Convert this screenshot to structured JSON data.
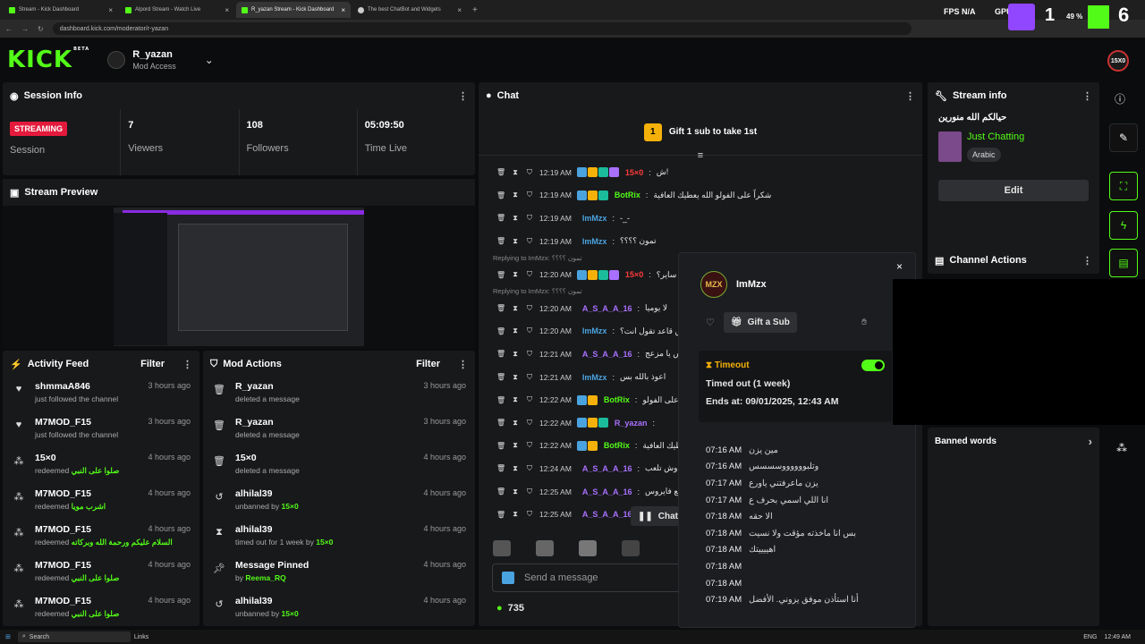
{
  "browser": {
    "tabs": [
      {
        "label": "Stream - Kick Dashboard",
        "active": false
      },
      {
        "label": "Alpord Stream - Watch Live",
        "active": false
      },
      {
        "label": "R_yazan Stream - Kick Dashboard",
        "active": true
      },
      {
        "label": "The best ChatBot and Widgets",
        "active": false
      }
    ],
    "url": "dashboard.kick.com/moderator/r-yazan"
  },
  "overlay": {
    "fps_label": "FPS",
    "fps_value": "N/A",
    "gpu_label": "GPU",
    "gpu_value": "49 %",
    "digit_1": "1",
    "digit_2": "6"
  },
  "header": {
    "logo": "KICK",
    "beta": "BETA",
    "username": "R_yazan",
    "role": "Mod Access",
    "badge": "15X0"
  },
  "session": {
    "title": "Session Info",
    "status": "STREAMING",
    "status_label": "Session",
    "viewers": "7",
    "viewers_label": "Viewers",
    "followers": "108",
    "followers_label": "Followers",
    "time_live": "05:09:50",
    "time_live_label": "Time Live"
  },
  "preview": {
    "title": "Stream Preview"
  },
  "activity": {
    "title": "Activity Feed",
    "filter": "Filter",
    "items": [
      {
        "name": "shmmaA846",
        "time": "3 hours ago",
        "action": "just followed the channel",
        "extra": "",
        "icon": "heart-icon"
      },
      {
        "name": "M7MOD_F15",
        "time": "3 hours ago",
        "action": "just followed the channel",
        "extra": "",
        "icon": "heart-icon"
      },
      {
        "name": "15×0",
        "time": "4 hours ago",
        "action": "redeemed",
        "extra": "صلوا على النبي",
        "icon": "redeem-icon"
      },
      {
        "name": "M7MOD_F15",
        "time": "4 hours ago",
        "action": "redeemed",
        "extra": "اشرب مويا",
        "icon": "redeem-icon"
      },
      {
        "name": "M7MOD_F15",
        "time": "4 hours ago",
        "action": "redeemed",
        "extra": "السلام عليكم ورحمة الله وبركاته",
        "icon": "redeem-icon"
      },
      {
        "name": "M7MOD_F15",
        "time": "4 hours ago",
        "action": "redeemed",
        "extra": "صلوا على النبي",
        "icon": "redeem-icon"
      },
      {
        "name": "M7MOD_F15",
        "time": "4 hours ago",
        "action": "redeemed",
        "extra": "صلوا على النبي",
        "icon": "redeem-icon"
      }
    ]
  },
  "modactions": {
    "title": "Mod Actions",
    "filter": "Filter",
    "items": [
      {
        "name": "R_yazan",
        "time": "3 hours ago",
        "action": "deleted a message",
        "extra": "",
        "icon": "trash-icon"
      },
      {
        "name": "R_yazan",
        "time": "3 hours ago",
        "action": "deleted a message",
        "extra": "",
        "icon": "trash-icon"
      },
      {
        "name": "15×0",
        "time": "4 hours ago",
        "action": "deleted a message",
        "extra": "",
        "icon": "trash-icon"
      },
      {
        "name": "alhilal39",
        "time": "4 hours ago",
        "action": "unbanned by",
        "extra": "15×0",
        "icon": "undo-icon"
      },
      {
        "name": "alhilal39",
        "time": "4 hours ago",
        "action": "timed out for 1 week by",
        "extra": "15×0",
        "icon": "hourglass-icon"
      },
      {
        "name": "Message Pinned",
        "time": "4 hours ago",
        "action": "by",
        "extra": "Reema_RQ",
        "icon": "pin-icon"
      },
      {
        "name": "alhilal39",
        "time": "4 hours ago",
        "action": "unbanned by",
        "extra": "15×0",
        "icon": "undo-icon"
      }
    ]
  },
  "chat": {
    "title": "Chat",
    "gift_text": "Gift 1 sub to take 1st",
    "gift_rank": "1",
    "pause_label": "Chat p",
    "input_placeholder": "Send a message",
    "count": "735",
    "messages": [
      {
        "reply": "",
        "time": "12:19 AM",
        "name": "15×0",
        "color": "#ff3b3b",
        "text": "ش!",
        "badges": 4
      },
      {
        "reply": "",
        "time": "12:19 AM",
        "name": "BotRix",
        "color": "#53fc18",
        "text": "شكراً على الفولو الله يعطيك العافية",
        "badges": 3
      },
      {
        "reply": "",
        "time": "12:19 AM",
        "name": "ImMzx",
        "color": "#4aa3df",
        "text": "-_-",
        "badges": 0
      },
      {
        "reply": "",
        "time": "12:19 AM",
        "name": "ImMzx",
        "color": "#4aa3df",
        "text": "تمون ؟؟؟؟",
        "badges": 0
      },
      {
        "reply": "Replying to ImMzx: تمون ؟؟؟؟",
        "time": "12:20 AM",
        "name": "15×0",
        "color": "#ff3b3b",
        "text": "ساير؟",
        "badges": 4
      },
      {
        "reply": "Replying to ImMzx: تمون ؟؟؟؟",
        "time": "12:20 AM",
        "name": "A_S_A_A_16",
        "color": "#a970ff",
        "text": "لا يوميا",
        "badges": 0
      },
      {
        "reply": "",
        "time": "12:20 AM",
        "name": "ImMzx",
        "color": "#4aa3df",
        "text": "وش قاعد تقول انت؟",
        "badges": 0
      },
      {
        "reply": "",
        "time": "12:21 AM",
        "name": "A_S_A_A_16",
        "color": "#a970ff",
        "text": "الحس يا مزعج",
        "badges": 0
      },
      {
        "reply": "",
        "time": "12:21 AM",
        "name": "ImMzx",
        "color": "#4aa3df",
        "text": "اعوذ بالله بس",
        "badges": 0
      },
      {
        "reply": "",
        "time": "12:22 AM",
        "name": "BotRix",
        "color": "#53fc18",
        "text": "شكراً على الفولو",
        "badges": 2
      },
      {
        "reply": "",
        "time": "12:22 AM",
        "name": "R_yazan",
        "color": "#a970ff",
        "text": "",
        "badges": 3
      },
      {
        "reply": "",
        "time": "12:22 AM",
        "name": "BotRix",
        "color": "#53fc18",
        "text": "يعطيك العافية",
        "badges": 2
      },
      {
        "reply": "",
        "time": "12:24 AM",
        "name": "A_S_A_A_16",
        "color": "#a970ff",
        "text": "يزن وش تلعب",
        "badges": 0
      },
      {
        "reply": "",
        "time": "12:25 AM",
        "name": "A_S_A_A_16",
        "color": "#a970ff",
        "text": "مقاطع فايروس",
        "badges": 0
      },
      {
        "reply": "",
        "time": "12:25 AM",
        "name": "A_S_A_A_16",
        "color": "#a970ff",
        "text": "",
        "badges": 0
      }
    ]
  },
  "popup": {
    "username": "ImMzx",
    "gift_button": "Gift a Sub",
    "timeout_label": "Timeout",
    "timed_out": "Timed out (1 week)",
    "ends_at": "Ends at: 09/01/2025, 12:43 AM",
    "messages": [
      {
        "time": "07:16 AM",
        "text": "مين يزن"
      },
      {
        "time": "07:16 AM",
        "text": "وتلبووووووسسسس"
      },
      {
        "time": "07:17 AM",
        "text": "يزن ماعرفتني ياورع"
      },
      {
        "time": "07:17 AM",
        "text": "انا اللي اسمي بحرف ع"
      },
      {
        "time": "07:18 AM",
        "text": "الا حقه"
      },
      {
        "time": "07:18 AM",
        "text": "بس انا ماخذته مؤقت ولا نسيت"
      },
      {
        "time": "07:18 AM",
        "text": "اهييييتك"
      },
      {
        "time": "07:18 AM",
        "text": ""
      },
      {
        "time": "07:18 AM",
        "text": ""
      },
      {
        "time": "07:19 AM",
        "text": "أنا استأذن موفق يزوني. الأفضل"
      }
    ]
  },
  "streaminfo": {
    "title": "Stream info",
    "stream_title": "حيالكم الله منورين",
    "category": "Just Chatting",
    "language": "Arabic",
    "edit_button": "Edit"
  },
  "channel": {
    "title": "Channel Actions",
    "banned_words": "Banned words"
  },
  "taskbar": {
    "search": "Search",
    "links": "Links",
    "lang": "ENG",
    "clock": "12:49 AM"
  },
  "colors": {
    "kick_green": "#53fc18",
    "live_red": "#e41a3c",
    "gold": "#f5b10a"
  }
}
